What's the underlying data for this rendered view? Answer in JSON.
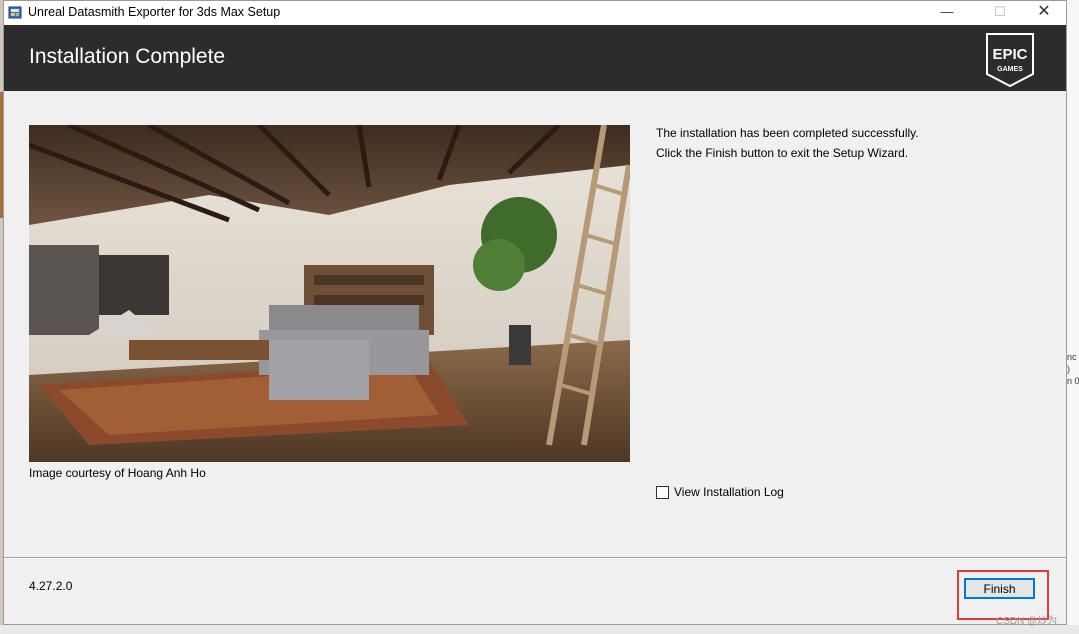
{
  "window": {
    "title": "Unreal Datasmith Exporter for 3ds Max Setup",
    "minimize_glyph": "—",
    "maximize_glyph": "☐",
    "close_glyph": "✕"
  },
  "header": {
    "title": "Installation Complete",
    "logo": {
      "line1": "EPIC",
      "line2": "GAMES"
    }
  },
  "content": {
    "image_caption": "Image courtesy of Hoang Anh Ho",
    "message_line1": "The installation has been completed successfully.",
    "message_line2": "Click the Finish button to exit the Setup Wizard.",
    "view_log_label": "View Installation Log",
    "view_log_checked": false
  },
  "footer": {
    "version": "4.27.2.0",
    "finish_label": "Finish"
  },
  "background": {
    "right_edge_text": "nc\n)\nn 0"
  },
  "watermark": "CSDN @炒为",
  "colors": {
    "header_bg": "#2c2c2c",
    "window_bg": "#f0f0f0",
    "button_focus": "#0078d7",
    "annotation_red": "#e03c3c"
  }
}
